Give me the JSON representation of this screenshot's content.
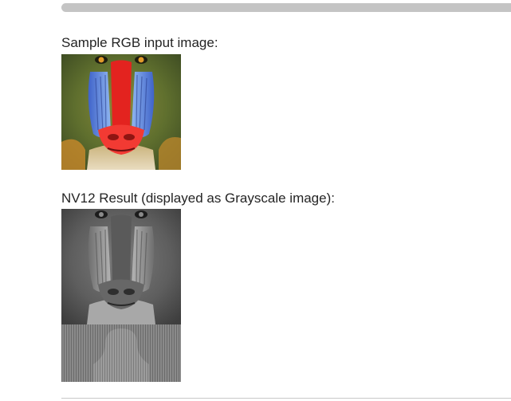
{
  "scroll": {
    "name": "horizontal-scrollbar"
  },
  "sections": [
    {
      "caption": "Sample RGB input image:",
      "image": "mandrill-rgb-image"
    },
    {
      "caption": "NV12 Result (displayed as Grayscale image):",
      "image": "mandrill-nv12-grayscale-image"
    }
  ]
}
